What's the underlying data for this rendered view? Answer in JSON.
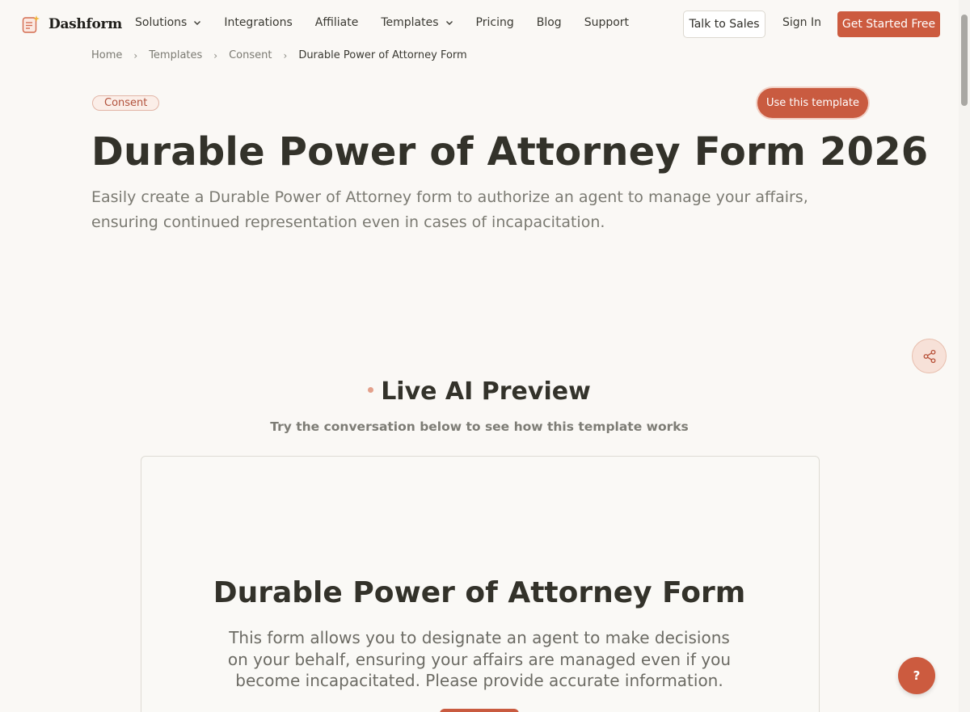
{
  "brand": {
    "name": "Dashform"
  },
  "nav": {
    "links": [
      {
        "label": "Solutions",
        "has_dropdown": true
      },
      {
        "label": "Integrations",
        "has_dropdown": false
      },
      {
        "label": "Affiliate",
        "has_dropdown": false
      },
      {
        "label": "Templates",
        "has_dropdown": true
      },
      {
        "label": "Pricing",
        "has_dropdown": false
      },
      {
        "label": "Blog",
        "has_dropdown": false
      },
      {
        "label": "Support",
        "has_dropdown": false
      }
    ],
    "talk_to_sales": "Talk to Sales",
    "sign_in": "Sign In",
    "get_started": "Get Started Free"
  },
  "breadcrumb": [
    "Home",
    "Templates",
    "Consent",
    "Durable Power of Attorney Form"
  ],
  "hero": {
    "tag": "Consent",
    "use_template": "Use this template",
    "title": "Durable Power of Attorney Form 2026",
    "subtitle": "Easily create a Durable Power of Attorney form to authorize an agent to manage your affairs, ensuring continued representation even in cases of incapacitation."
  },
  "preview": {
    "heading": "Live AI Preview",
    "subheading": "Try the conversation below to see how this template works",
    "card_title": "Durable Power of Attorney Form",
    "card_description": "This form allows you to designate an agent to make decisions on your behalf, ensuring your affairs are managed even if you become incapacitated. Please provide accurate information."
  },
  "help_button": "?",
  "colors": {
    "accent": "#cc5b3f",
    "background": "#faf8f5",
    "text": "#33322a"
  },
  "icons": {
    "share": "share-icon",
    "logo": "form-sparkle-icon",
    "chevron": "chevron-down-icon"
  }
}
